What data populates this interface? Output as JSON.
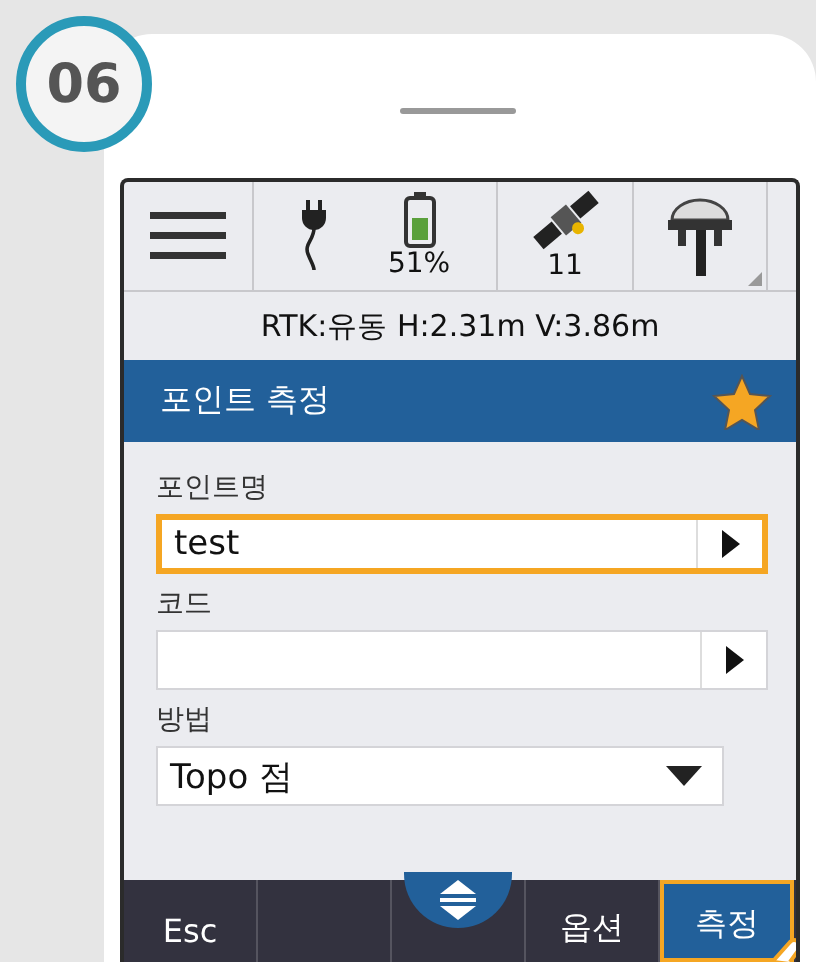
{
  "step_badge": "06",
  "status_bar": {
    "battery": "51%",
    "satellites": "11"
  },
  "rtk_status": "RTK:유동 H:2.31m V:3.86m",
  "title_bar": {
    "title": "포인트 측정",
    "favorite": true
  },
  "fields": [
    {
      "kind": "text",
      "label": "포인트명",
      "value": "test",
      "focused": true
    },
    {
      "kind": "text",
      "label": "코드",
      "focused": false
    },
    {
      "kind": "select",
      "label": "방법",
      "value": "Topo 점",
      "focused": false
    }
  ],
  "softkeys": [
    {
      "kind": "text",
      "label": "Esc",
      "selected": false
    },
    {
      "kind": "blank",
      "selected": false
    },
    {
      "kind": "toggle",
      "selected": false
    },
    {
      "kind": "text",
      "label": "옵션",
      "selected": false
    },
    {
      "kind": "text",
      "label": "측정",
      "selected": true
    }
  ]
}
